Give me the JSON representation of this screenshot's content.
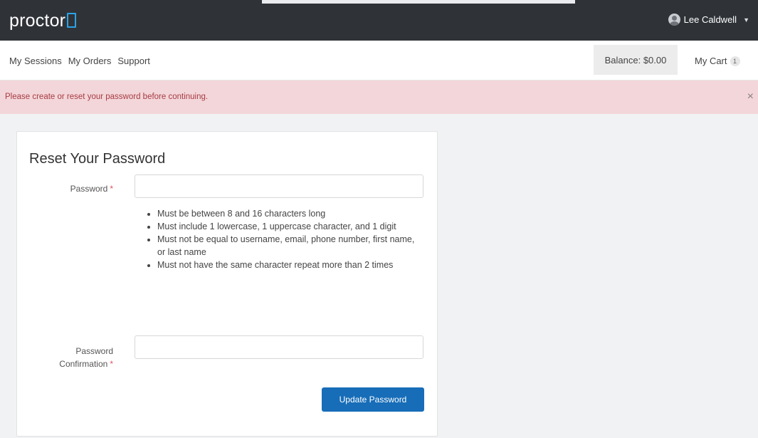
{
  "header": {
    "logo_text": "proctor",
    "user_name": "Lee Caldwell",
    "accent_color": "#2aa3e8"
  },
  "nav": {
    "links": [
      "My Sessions",
      "My Orders",
      "Support"
    ],
    "balance": "Balance: $0.00",
    "cart_label": "My Cart",
    "cart_count": "1"
  },
  "alert": {
    "message": "Please create or reset your password before continuing.",
    "close_label": "×"
  },
  "form": {
    "title": "Reset Your Password",
    "password_label": "Password",
    "required_mark": "*",
    "password_value": "",
    "rules": [
      "Must be between 8 and 16 characters long",
      "Must include 1 lowercase, 1 uppercase character, and 1 digit",
      "Must not be equal to username, email, phone number, first name, or last name",
      "Must not have the same character repeat more than 2 times"
    ],
    "confirmation_label_line1": "Password",
    "confirmation_label_line2": "Confirmation",
    "confirmation_value": "",
    "submit_label": "Update Password"
  }
}
